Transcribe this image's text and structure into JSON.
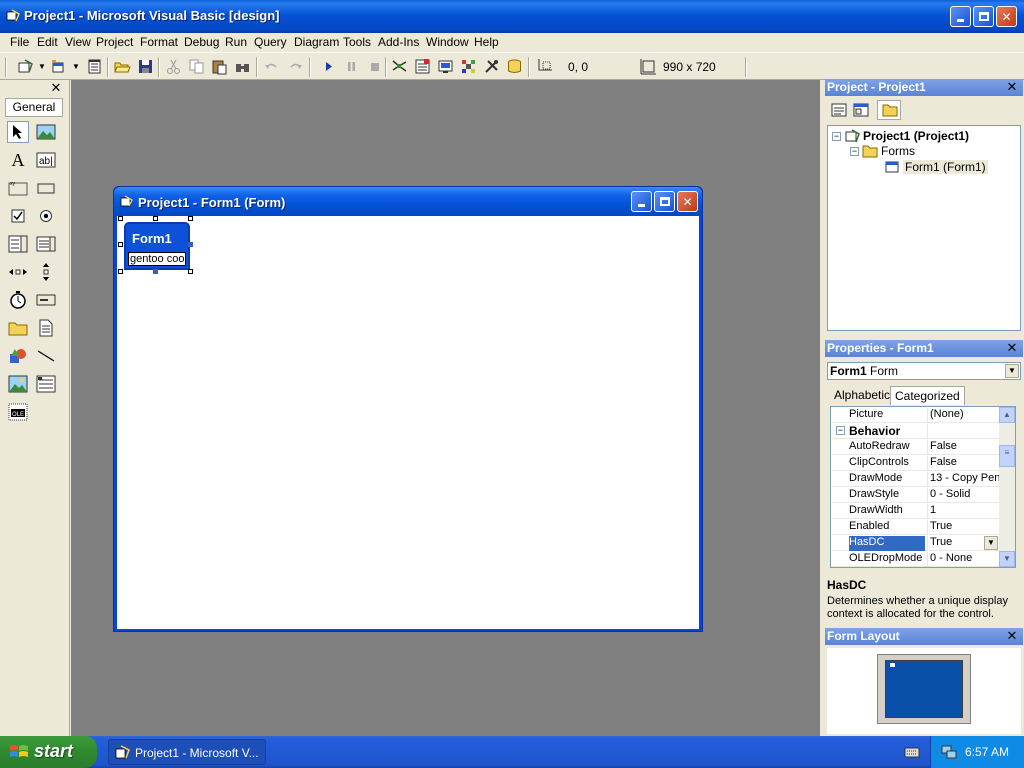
{
  "window": {
    "title": "Project1 - Microsoft Visual Basic [design]"
  },
  "menu": [
    "File",
    "Edit",
    "View",
    "Project",
    "Format",
    "Debug",
    "Run",
    "Query",
    "Diagram",
    "Tools",
    "Add-Ins",
    "Window",
    "Help"
  ],
  "toolbar": {
    "position": "0, 0",
    "size": "990 x 720"
  },
  "toolbox": {
    "tab": "General",
    "tools": [
      "pointer-icon",
      "picturebox-icon",
      "label-icon",
      "textbox-icon",
      "frame-icon",
      "commandbutton-icon",
      "checkbox-icon",
      "optionbutton-icon",
      "combobox-icon",
      "listbox-icon",
      "hscrollbar-icon",
      "vscrollbar-icon",
      "timer-icon",
      "drivelistbox-icon",
      "dirlistbox-icon",
      "filelistbox-icon",
      "shape-icon",
      "line-icon",
      "image-icon",
      "data-icon",
      "ole-icon"
    ]
  },
  "form_window": {
    "title": "Project1 - Form1 (Form)",
    "mini_form_title": "Form1",
    "mini_form_text": "gentoo cool"
  },
  "project_panel": {
    "title": "Project - Project1",
    "tree": [
      {
        "label": "Project1 (Project1)",
        "level": 0
      },
      {
        "label": "Forms",
        "level": 1
      },
      {
        "label": "Form1 (Form1)",
        "level": 2
      }
    ]
  },
  "properties_panel": {
    "title": "Properties - Form1",
    "object_name": "Form1",
    "object_type": "Form",
    "tabs": [
      "Alphabetic",
      "Categorized"
    ],
    "active_tab": "Categorized",
    "rows": [
      {
        "name": "Picture",
        "value": "(None)"
      },
      {
        "name": "Behavior",
        "value": "",
        "category": true
      },
      {
        "name": "AutoRedraw",
        "value": "False"
      },
      {
        "name": "ClipControls",
        "value": "False"
      },
      {
        "name": "DrawMode",
        "value": "13 - Copy Pen"
      },
      {
        "name": "DrawStyle",
        "value": "0 - Solid"
      },
      {
        "name": "DrawWidth",
        "value": "1"
      },
      {
        "name": "Enabled",
        "value": "True"
      },
      {
        "name": "HasDC",
        "value": "True",
        "selected": true
      },
      {
        "name": "OLEDropMode",
        "value": "0 - None"
      }
    ],
    "description_title": "HasDC",
    "description_text": "Determines whether a unique display context is allocated for the control."
  },
  "form_layout_panel": {
    "title": "Form Layout"
  },
  "taskbar": {
    "start_label": "start",
    "task_label": "Project1 - Microsoft V...",
    "clock": "6:57 AM"
  }
}
